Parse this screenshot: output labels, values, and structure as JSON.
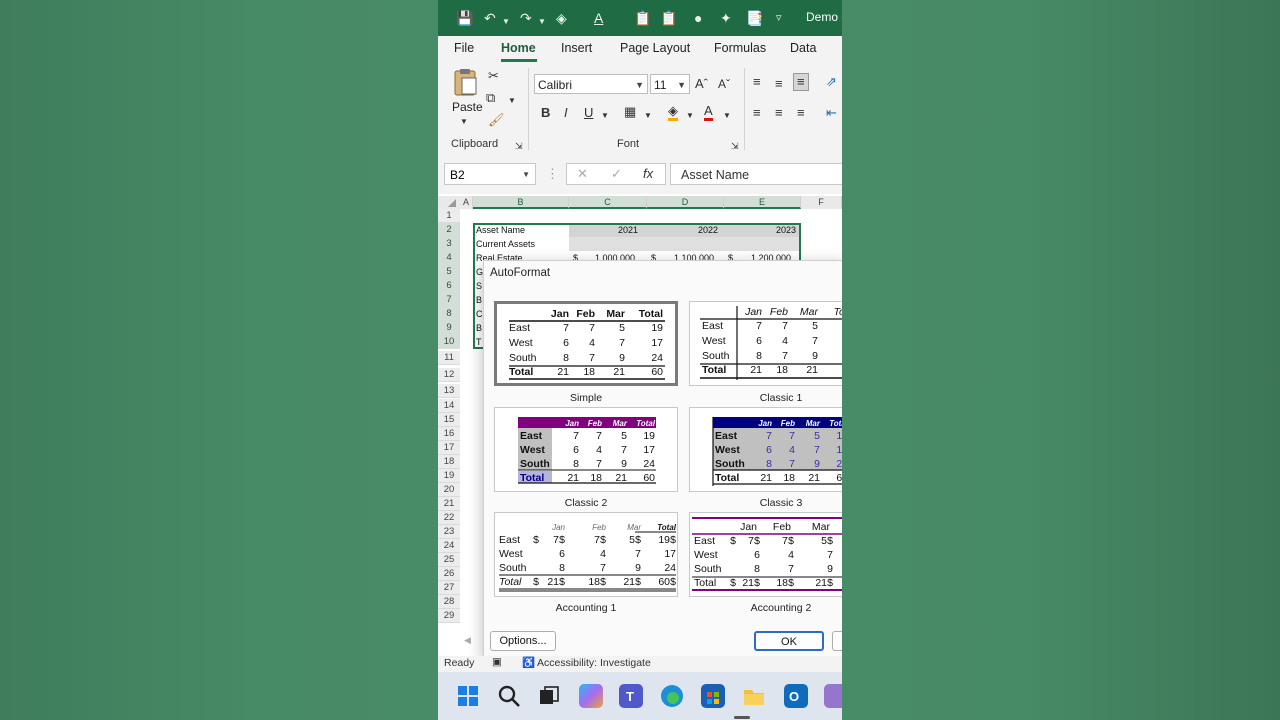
{
  "qat": {
    "title": "Demo d"
  },
  "tabs": [
    "File",
    "Home",
    "Insert",
    "Page Layout",
    "Formulas",
    "Data"
  ],
  "ribbon": {
    "clipboard": {
      "paste_label": "Paste",
      "group_label": "Clipboard"
    },
    "font": {
      "font_name": "Calibri",
      "font_size": "11",
      "group_label": "Font"
    }
  },
  "formula_bar": {
    "name_box": "B2",
    "formula": "Asset Name"
  },
  "grid": {
    "columns": [
      "A",
      "B",
      "C",
      "D",
      "E",
      "F"
    ],
    "rows": [
      "1",
      "2",
      "3",
      "4",
      "5",
      "6",
      "7",
      "8",
      "9",
      "10",
      "11",
      "12",
      "13",
      "14",
      "15",
      "16",
      "17",
      "18",
      "19",
      "20",
      "21",
      "22",
      "23",
      "24",
      "25",
      "26",
      "27",
      "28",
      "29"
    ],
    "cells": {
      "b2": "Asset Name",
      "c2": "2021",
      "d2": "2022",
      "e2": "2023",
      "b3": "Current Assets",
      "b4": "Real Estate",
      "c4_sym": "$",
      "c4": "1,000,000",
      "d4_sym": "$",
      "d4": "1,100,000",
      "e4_sym": "$",
      "e4": "1,200,000",
      "b5": "G",
      "b6": "S",
      "b7": "B",
      "b8": "C",
      "b9": "B",
      "b10": "T"
    }
  },
  "dialog": {
    "title": "AutoFormat",
    "options_button": "Options...",
    "ok_button": "OK",
    "formats": [
      "Simple",
      "Classic 1",
      "Classic 2",
      "Classic 3",
      "Accounting 1",
      "Accounting 2"
    ],
    "selected": "Simple",
    "sample": {
      "headers": [
        "Jan",
        "Feb",
        "Mar",
        "Total"
      ],
      "rows": [
        {
          "name": "East",
          "values": [
            "7",
            "7",
            "5",
            "19"
          ]
        },
        {
          "name": "West",
          "values": [
            "6",
            "4",
            "7",
            "17"
          ]
        },
        {
          "name": "South",
          "values": [
            "8",
            "7",
            "9",
            "24"
          ]
        },
        {
          "name": "Total",
          "values": [
            "21",
            "18",
            "21",
            "60"
          ]
        }
      ],
      "currency_symbol": "$"
    }
  },
  "status": {
    "ready": "Ready",
    "accessibility": "Accessibility: Investigate"
  },
  "colors": {
    "excel_green": "#1f6b44",
    "classic2_header": "#800080",
    "classic3_header": "#000080",
    "selection": "#1f7a4c"
  }
}
